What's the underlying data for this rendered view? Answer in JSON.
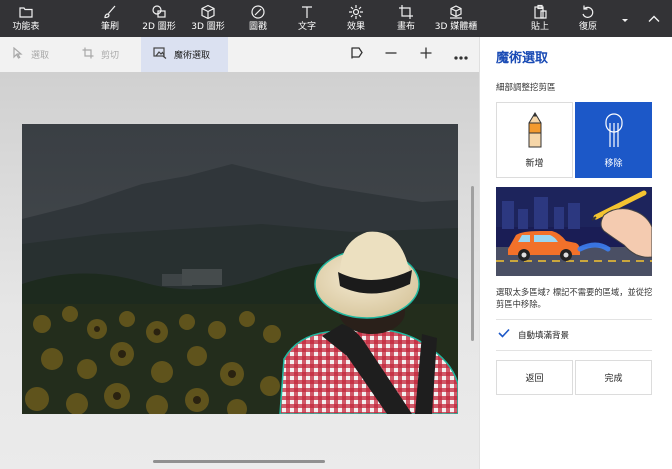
{
  "toolbar": {
    "menu": {
      "label": "功能表",
      "icon": "folder-icon"
    },
    "tools": [
      {
        "label": "筆刷",
        "icon": "brush-icon"
      },
      {
        "label": "2D 圖形",
        "icon": "2d-shapes-icon"
      },
      {
        "label": "3D 圖形",
        "icon": "3d-shapes-icon"
      },
      {
        "label": "圖戳",
        "icon": "sticker-icon"
      },
      {
        "label": "文字",
        "icon": "text-icon"
      },
      {
        "label": "效果",
        "icon": "effects-icon"
      },
      {
        "label": "畫布",
        "icon": "canvas-icon"
      },
      {
        "label": "3D 媒體櫃",
        "icon": "3d-library-icon"
      }
    ],
    "paste": {
      "label": "貼上",
      "icon": "paste-icon"
    },
    "undo": {
      "label": "復原",
      "icon": "undo-icon"
    }
  },
  "subbar": {
    "select": "選取",
    "crop": "剪切",
    "magic_select": "魔術選取"
  },
  "panel": {
    "title": "魔術選取",
    "subtitle": "細部調整挖剪區",
    "add_label": "新增",
    "remove_label": "移除",
    "selected_mode": "remove",
    "hint": "選取太多區域? 標記不需要的區域，並從挖剪區中移除。",
    "autofill_label": "自動填滿背景",
    "autofill_checked": true,
    "back_label": "返回",
    "done_label": "完成"
  },
  "colors": {
    "toolbar_bg": "#333336",
    "accent": "#1c58c8",
    "active_tab_bg": "#dbe1f1",
    "panel_title": "#1a4bb5"
  }
}
